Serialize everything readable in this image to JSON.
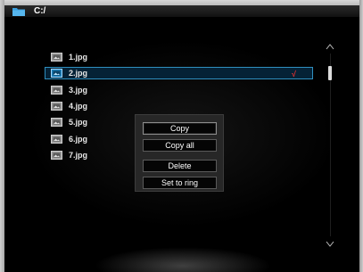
{
  "header": {
    "path": "C:/",
    "icon": "folder-icon"
  },
  "files": [
    {
      "name": "1.jpg",
      "icon": "image-file-icon",
      "selected": false,
      "checked": false
    },
    {
      "name": "2.jpg",
      "icon": "image-file-icon",
      "selected": true,
      "checked": true
    },
    {
      "name": "3.jpg",
      "icon": "image-file-icon",
      "selected": false,
      "checked": false
    },
    {
      "name": "4.jpg",
      "icon": "image-file-icon",
      "selected": false,
      "checked": false
    },
    {
      "name": "5.jpg",
      "icon": "image-file-icon",
      "selected": false,
      "checked": false
    },
    {
      "name": "6.jpg",
      "icon": "image-file-icon",
      "selected": false,
      "checked": false
    },
    {
      "name": "7.jpg",
      "icon": "image-file-icon",
      "selected": false,
      "checked": false
    }
  ],
  "check_mark": "√",
  "context_menu": {
    "items": [
      {
        "label": "Copy",
        "focused": true
      },
      {
        "label": "Copy all",
        "focused": false
      },
      {
        "label": "Delete",
        "focused": false
      },
      {
        "label": "Set to ring",
        "focused": false
      }
    ]
  },
  "colors": {
    "selection_fill": "#052236",
    "selection_border": "#2f8fbf",
    "check_mark": "#e03030",
    "folder_icon": "#3aa0e0"
  }
}
